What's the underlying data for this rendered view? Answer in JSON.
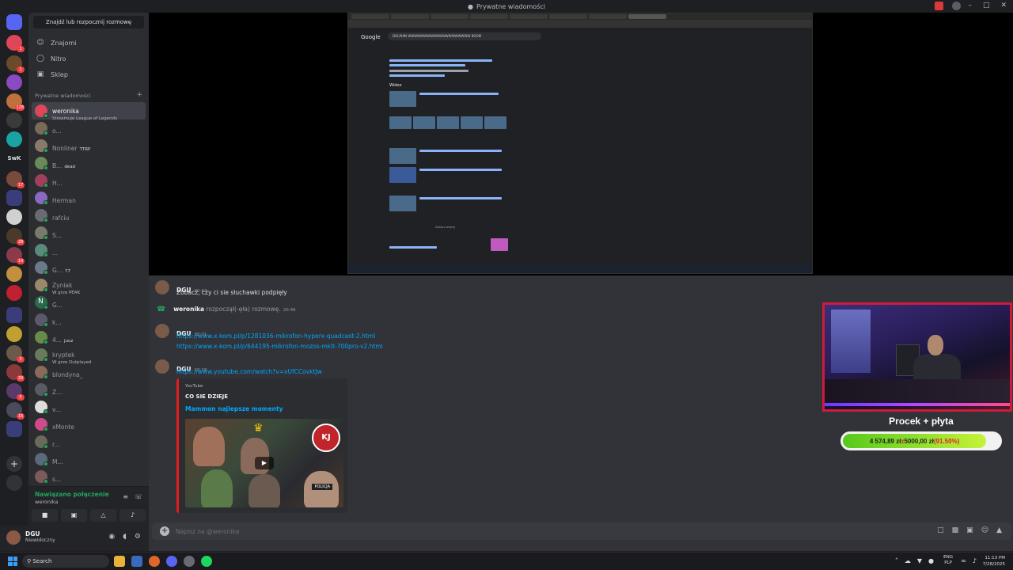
{
  "window": {
    "title": "Prywatne wiadomości"
  },
  "colors": {
    "accent": "#5865f2",
    "online": "#23a55a",
    "link": "#00a8fc",
    "youtube": "#e31c1c",
    "goal_fill": "#7bd12a"
  },
  "rail": {
    "labels": {
      "swk": "SwK"
    },
    "badges": {
      "b1": "1",
      "b2": "1",
      "b3": "128",
      "b4": "17",
      "b5": "28",
      "b6": "14",
      "b7": "3",
      "b8": "30",
      "b9": "5",
      "b10": "16"
    }
  },
  "sidebar": {
    "find_placeholder": "Znajdź lub rozpocznij rozmowę",
    "nav": {
      "friends": "Znajomi",
      "nitro": "Nitro",
      "shop": "Sklep"
    },
    "dm_header": "Prywatne wiadomości",
    "dm_add": "+",
    "dms": [
      {
        "name": "weronika",
        "sub": "Streamuje League of Legends",
        "color": "#e0465a"
      },
      {
        "name": "o...",
        "sub": "",
        "color": "#7a6a5a"
      },
      {
        "name": "Nonliner",
        "tag": "TTRP",
        "sub": "",
        "color": "#8a7a6a"
      },
      {
        "name": "B...",
        "tag": "dead",
        "sub": "",
        "color": "#6a8a5a"
      },
      {
        "name": "H...",
        "sub": "",
        "color": "#a0405a"
      },
      {
        "name": "Herman",
        "sub": "",
        "color": "#8a6ac0"
      },
      {
        "name": "rafciu",
        "sub": "",
        "color": "#6a6a72"
      },
      {
        "name": "S...",
        "sub": "",
        "color": "#7a7a6a"
      },
      {
        "name": "...",
        "sub": "",
        "color": "#5a8a7a"
      },
      {
        "name": "G...",
        "tag": "77",
        "sub": "",
        "color": "#6a7a8a"
      },
      {
        "name": "Zyniak",
        "sub": "W grze PEAK",
        "color": "#9a8a6a"
      },
      {
        "name": "G...",
        "sub": "",
        "color": "#2a6a4a",
        "letter": "N"
      },
      {
        "name": "k...",
        "sub": "",
        "color": "#5a5a6a"
      },
      {
        "name": "4...",
        "tag": "juuz",
        "sub": "",
        "color": "#6a8a4a"
      },
      {
        "name": "kryptek",
        "sub": "W grze Outplayed",
        "color": "#6a7a5a"
      },
      {
        "name": "blondyna_",
        "sub": "",
        "color": "#8a6a5a"
      },
      {
        "name": "Z...",
        "sub": "",
        "color": "#5a5a62"
      },
      {
        "name": "v...",
        "sub": "",
        "color": "#dddddd"
      },
      {
        "name": "xMonte",
        "sub": "",
        "color": "#d04a8a"
      },
      {
        "name": "r...",
        "sub": "",
        "color": "#6a6a5a"
      },
      {
        "name": "M...",
        "sub": "",
        "color": "#5a6a7a"
      },
      {
        "name": "s...",
        "sub": "",
        "color": "#7a5a5a"
      }
    ]
  },
  "voice": {
    "status": "Nawiązano połączenie",
    "user": "weronika"
  },
  "user": {
    "name": "DGU",
    "status": "Niewidoczny"
  },
  "screenshare": {
    "brand": "Google",
    "query": "DOLPHIN WWWWWWWWWWWWWWWWWWWW BOOM",
    "videos_header": "Wideo",
    "more": "Zobacz więcej"
  },
  "chat": {
    "m1": {
      "author": "DGU",
      "time": "20:42",
      "text": "Zobacz, czy ci sie słuchawki podpięły"
    },
    "sys": {
      "who": "weronika",
      "text": " rozpoczął(-ęła) rozmowę.",
      "time": "20:46"
    },
    "m2": {
      "author": "DGU",
      "time": "22:01",
      "link1": "https://www.x-kom.pl/p/1281036-mikrofon-hyperx-quadcast-2.html",
      "link2": "https://www.x-kom.pl/p/644195-mikrofon-mozos-mkit-700pro-v2.html"
    },
    "m3": {
      "author": "DGU",
      "time": "22:18",
      "link": "https://www.youtube.com/watch?v=xUfCCovktJw"
    },
    "embed": {
      "provider": "YouTube",
      "channel": "CO SIE DZIEJE",
      "title": "Mammon najlepsze momenty",
      "thumb_caption": "POLICJA",
      "thumb_logo": "KJ"
    }
  },
  "composer": {
    "placeholder": "Napisz na @weronika"
  },
  "stream_overlay": {
    "goal_title": "Procek + płyta",
    "goal_current": "4 574,89 zł",
    "goal_sep": " z ",
    "goal_target": "5000,00 zł",
    "goal_pct_label": " (91.50%)",
    "goal_progress": 0.915
  },
  "taskbar": {
    "search": "Search",
    "lang1": "ENG",
    "lang2": "PLP",
    "time": "11:13 PM",
    "date": "7/28/2025"
  }
}
